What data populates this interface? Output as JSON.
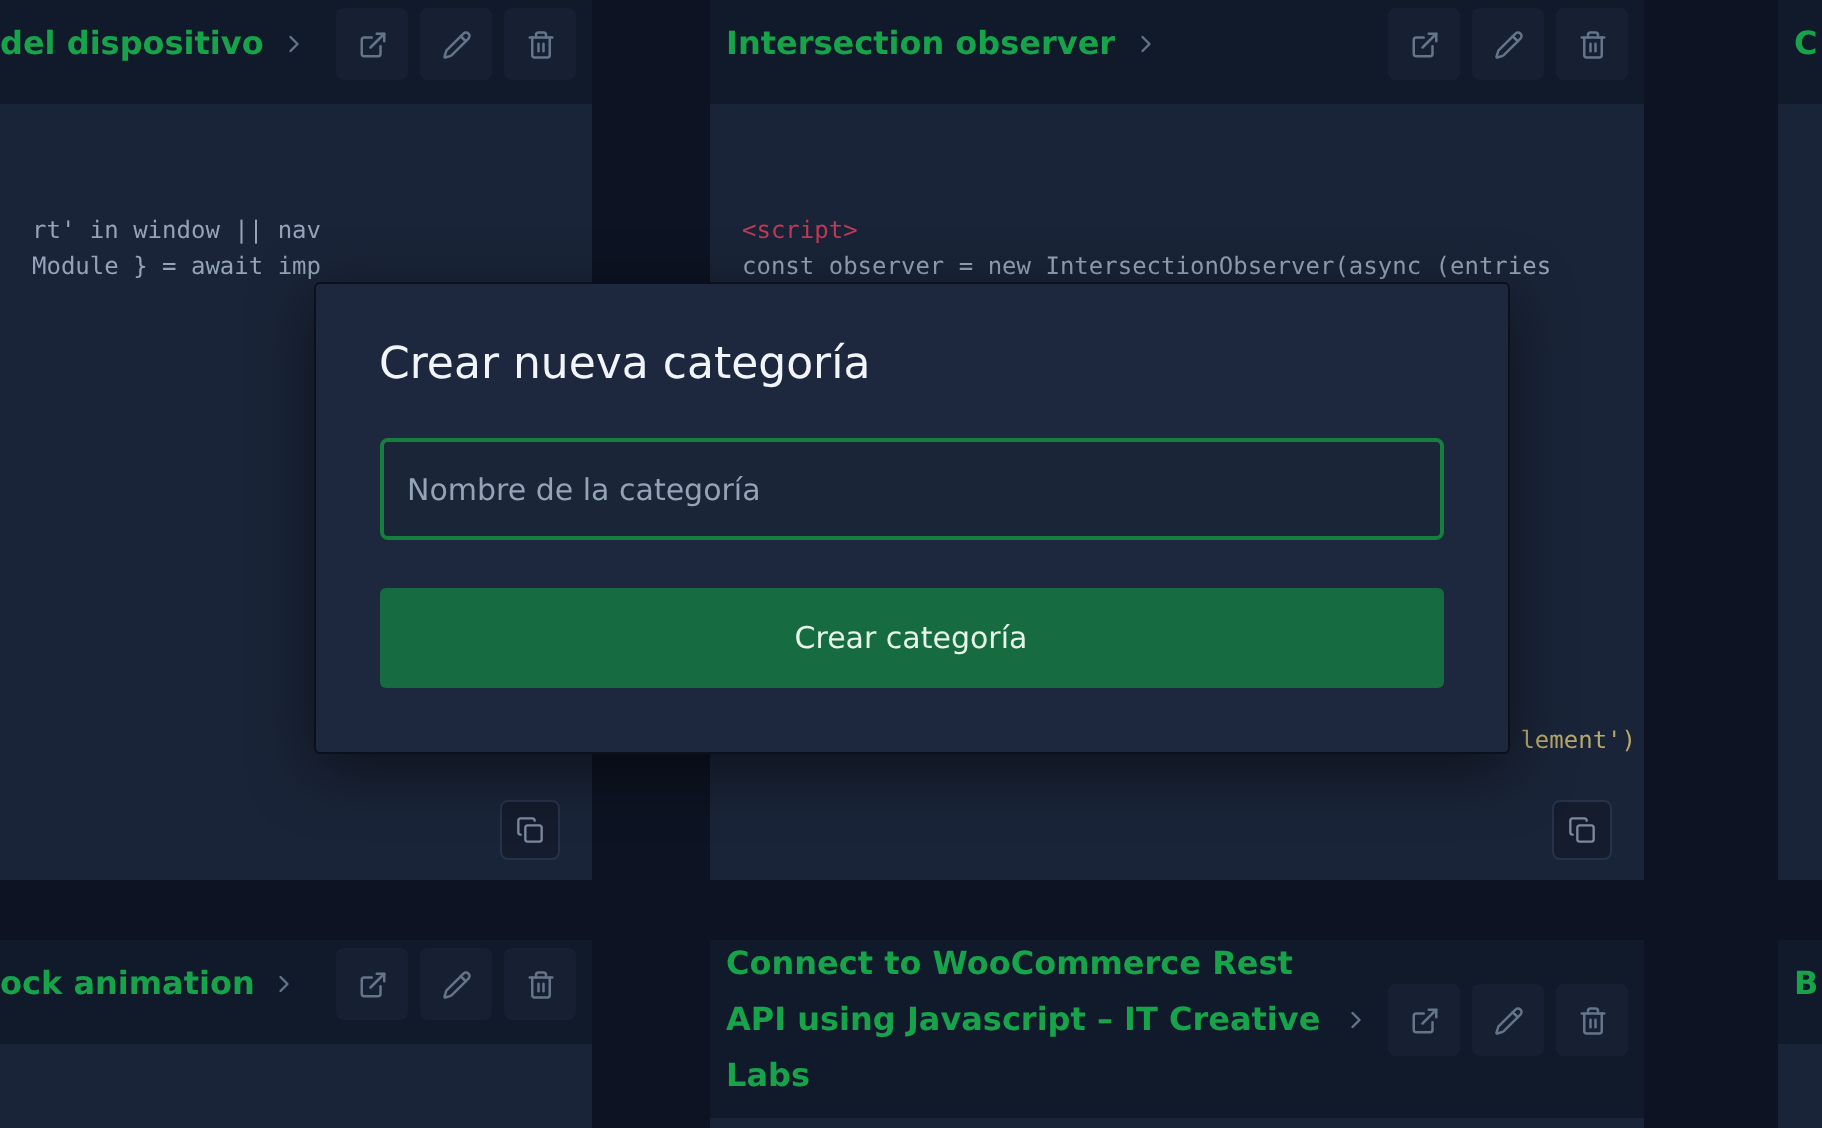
{
  "cards": [
    {
      "title": "del dispositivo",
      "code": [
        {
          "text": "rt' in window || nav",
          "color": "#94a3b8"
        },
        {
          "text": "Module } = await imp",
          "color": "#94a3b8"
        }
      ]
    },
    {
      "title": "Intersection observer",
      "code": [
        {
          "text": "<script>",
          "color": "#be3a55"
        },
        {
          "text": "const observer = new IntersectionObserver(async (entries",
          "color": "#94a3b8"
        },
        {
          "text": "lement')",
          "color": "#b8a86a",
          "kind": "tail"
        }
      ]
    },
    {
      "title": "C"
    },
    {
      "title": "ock animation"
    },
    {
      "title": "Connect to WooCommerce Rest API using Javascript – IT Creative Labs"
    },
    {
      "title": "B"
    }
  ],
  "dialog": {
    "title": "Crear nueva categoría",
    "input": {
      "placeholder": "Nombre de la categoría",
      "focused": true
    },
    "button": "Crear categoría"
  }
}
